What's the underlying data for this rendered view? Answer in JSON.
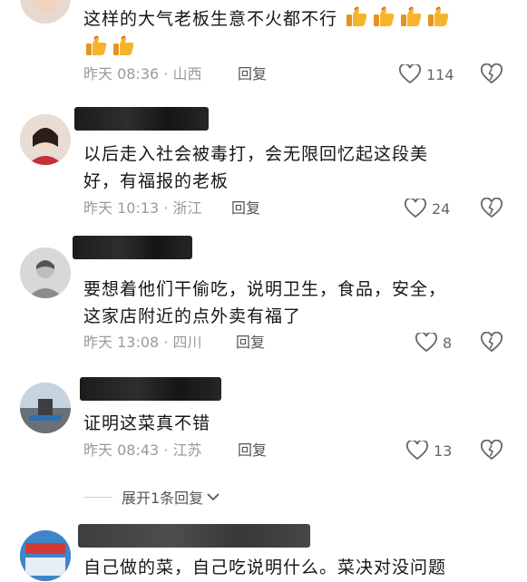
{
  "comments": [
    {
      "text_lines": [
        "这样的大气老板生意不火都不行"
      ],
      "emoji_thumbs_line1": 4,
      "emoji_thumbs_line2": 2,
      "time": "昨天 08:36 · 山西",
      "reply": "回复",
      "likes": "114"
    },
    {
      "text_lines": [
        "以后走入社会被毒打，会无限回忆起这段美",
        "好，有福报的老板"
      ],
      "time": "昨天 10:13 · 浙江",
      "reply": "回复",
      "likes": "24"
    },
    {
      "text_lines": [
        "要想着他们干偷吃，说明卫生，食品，安全，",
        "这家店附近的点外卖有福了"
      ],
      "time": "昨天 13:08 · 四川",
      "reply": "回复",
      "likes": "8"
    },
    {
      "text_lines": [
        "证明这菜真不错"
      ],
      "time": "昨天 08:43 · 江苏",
      "reply": "回复",
      "likes": "13"
    },
    {
      "text_lines": [
        "自己做的菜，自己吃说明什么。菜决对没问题"
      ]
    }
  ],
  "expand_replies": "展开1条回复",
  "icons": {
    "like": "heart-outline-icon",
    "dislike": "broken-heart-icon",
    "expand": "chevron-down-icon",
    "emoji": "thumbs-up-emoji"
  },
  "colors": {
    "meta_gray": "#9a9a9a",
    "emoji_yellow": "#f6b42a"
  }
}
